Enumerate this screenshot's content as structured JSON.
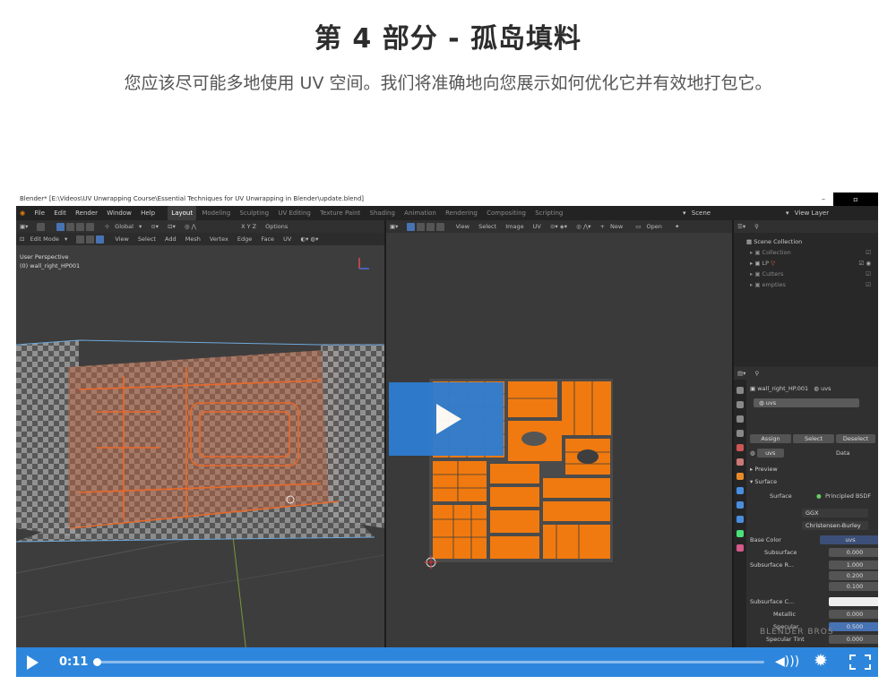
{
  "page": {
    "title": "第 4 部分 - 孤岛填料",
    "description": "您应该尽可能多地使用 UV 空间。我们将准确地向您展示如何优化它并有效地打包它。"
  },
  "blender": {
    "window_title": "Blender* [E:\\Videos\\UV Unwrapping Course\\Essential Techniques for UV Unwrapping in Blender\\update.blend]",
    "menu": [
      "File",
      "Edit",
      "Render",
      "Window",
      "Help"
    ],
    "workspaces": [
      "Layout",
      "Modeling",
      "Sculpting",
      "UV Editing",
      "Texture Paint",
      "Shading",
      "Animation",
      "Rendering",
      "Compositing",
      "Scripting"
    ],
    "active_workspace": "Layout",
    "scene": "Scene",
    "view_layer": "View Layer",
    "viewport_header": {
      "mode": "Edit Mode",
      "menus": [
        "View",
        "Select",
        "Add",
        "Mesh",
        "Vertex",
        "Edge",
        "Face",
        "UV"
      ],
      "orientation": "Global",
      "options": "Options"
    },
    "uv_header": {
      "menus": [
        "View",
        "Select",
        "Image",
        "UV"
      ],
      "new": "New",
      "open": "Open"
    },
    "viewport_info": {
      "perspective": "User Perspective",
      "object": "(0) wall_right_HP001"
    },
    "outliner": {
      "root": "Scene Collection",
      "items": [
        "Collection",
        "LP",
        "Cutters",
        "empties"
      ]
    },
    "properties": {
      "object": "wall_right_HP.001",
      "material_tab": "uvs",
      "slot": "uvs",
      "buttons": [
        "Assign",
        "Select",
        "Deselect"
      ],
      "data_label": "Data",
      "preview": "Preview",
      "surface_section": "Surface",
      "surface_label": "Surface",
      "surface_value": "Principled BSDF",
      "distribution": "GGX",
      "subsurface_method": "Christensen-Burley",
      "rows": [
        {
          "label": "Base Color",
          "value": "uvs"
        },
        {
          "label": "Subsurface",
          "value": "0.000"
        },
        {
          "label": "Subsurface R...",
          "value": "1.000"
        },
        {
          "label": "",
          "value": "0.200"
        },
        {
          "label": "",
          "value": "0.100"
        },
        {
          "label": "Subsurface C...",
          "value": ""
        },
        {
          "label": "Metallic",
          "value": "0.000"
        },
        {
          "label": "Specular",
          "value": "0.500"
        },
        {
          "label": "Specular Tint",
          "value": "0.000"
        }
      ]
    }
  },
  "player": {
    "time": "0:11",
    "progress": 0.0,
    "icons": [
      "play-icon",
      "volume-icon",
      "settings-icon",
      "fullscreen-icon"
    ]
  },
  "watermark": "BLENDER BROS",
  "colors": {
    "accent": "#2d86dc",
    "uv_orange": "#f07a10",
    "mesh_orange": "#e8692a"
  }
}
